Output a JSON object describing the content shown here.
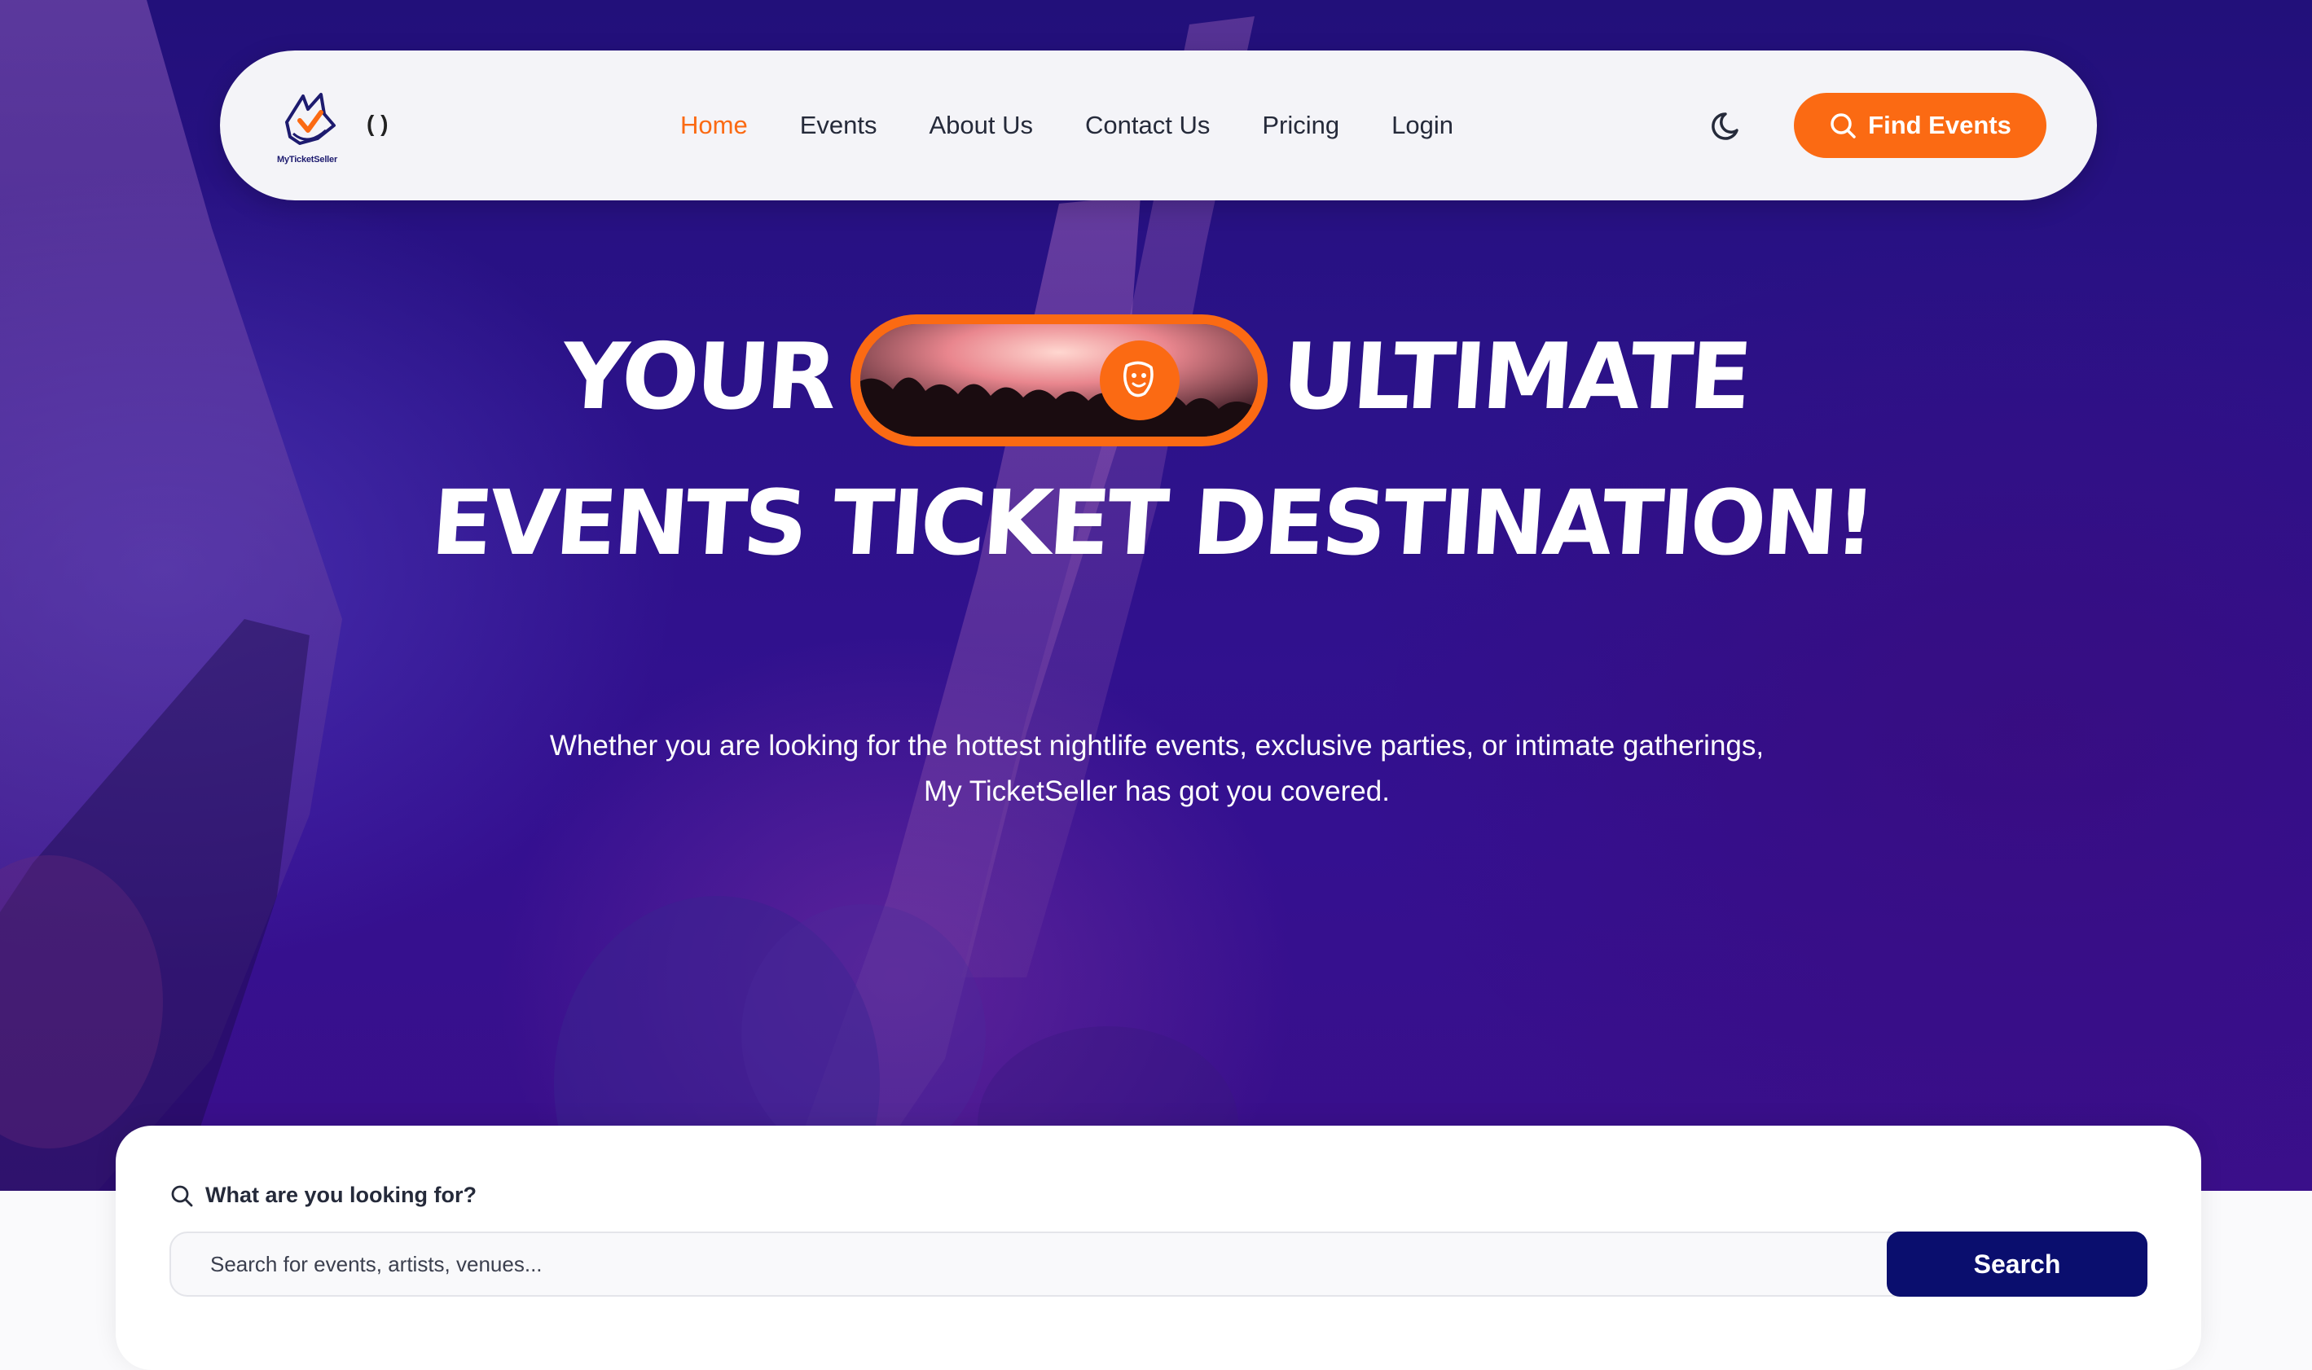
{
  "brand": {
    "name": "MyTicketSeller",
    "lang_toggle": "( )"
  },
  "nav": {
    "items": [
      {
        "label": "Home",
        "active": true
      },
      {
        "label": "Events",
        "active": false
      },
      {
        "label": "About Us",
        "active": false
      },
      {
        "label": "Contact Us",
        "active": false
      },
      {
        "label": "Pricing",
        "active": false
      },
      {
        "label": "Login",
        "active": false
      }
    ],
    "theme_icon": "moon-icon",
    "cta_label": "Find Events"
  },
  "hero": {
    "headline_word1": "YOUR",
    "headline_word2": "ULTIMATE",
    "headline_line2": "EVENTS TICKET DESTINATION!",
    "subtitle_line1": "Whether you are looking for the hottest nightlife events, exclusive parties, or intimate gatherings,",
    "subtitle_line2": "My TicketSeller has got you covered."
  },
  "search": {
    "label": "What are you looking for?",
    "placeholder": "Search for events, artists, venues...",
    "value": "",
    "button_label": "Search"
  },
  "colors": {
    "accent": "#fb6a13",
    "primary_dark": "#0a0e6e",
    "hero_bg": "#2c128a",
    "text": "#252a3a"
  }
}
